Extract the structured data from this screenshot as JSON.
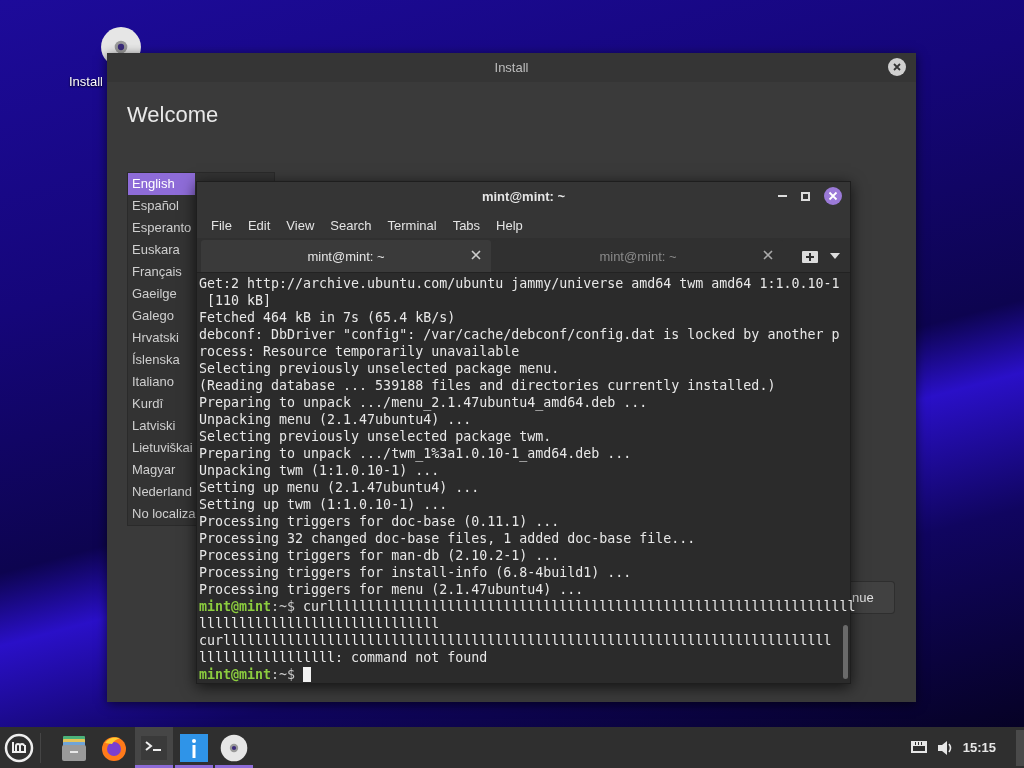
{
  "desktop_icon": {
    "label": "Install"
  },
  "install_window": {
    "title": "Install",
    "heading": "Welcome",
    "languages": [
      {
        "label": "English",
        "selected": true
      },
      {
        "label": "Español",
        "selected": false
      },
      {
        "label": "Esperanto",
        "selected": false
      },
      {
        "label": "Euskara",
        "selected": false
      },
      {
        "label": "Français",
        "selected": false
      },
      {
        "label": "Gaeilge",
        "selected": false
      },
      {
        "label": "Galego",
        "selected": false
      },
      {
        "label": "Hrvatski",
        "selected": false
      },
      {
        "label": "Íslenska",
        "selected": false
      },
      {
        "label": "Italiano",
        "selected": false
      },
      {
        "label": "Kurdî",
        "selected": false
      },
      {
        "label": "Latviski",
        "selected": false
      },
      {
        "label": "Lietuviškai",
        "selected": false
      },
      {
        "label": "Magyar",
        "selected": false
      },
      {
        "label": "Nederland",
        "selected": false
      },
      {
        "label": "No localiza",
        "selected": false
      }
    ],
    "button": "nue"
  },
  "terminal": {
    "title": "mint@mint: ~",
    "menu": [
      "File",
      "Edit",
      "View",
      "Search",
      "Terminal",
      "Tabs",
      "Help"
    ],
    "tabs": [
      {
        "label": "mint@mint: ~",
        "selected": true
      },
      {
        "label": "mint@mint: ~",
        "selected": false
      }
    ],
    "lines": [
      {
        "kind": "text",
        "text": "Get:2 http://archive.ubuntu.com/ubuntu jammy/universe amd64 twm amd64 1:1.0.10-1"
      },
      {
        "kind": "text",
        "text": " [110 kB]"
      },
      {
        "kind": "text",
        "text": "Fetched 464 kB in 7s (65.4 kB/s)"
      },
      {
        "kind": "text",
        "text": "debconf: DbDriver \"config\": /var/cache/debconf/config.dat is locked by another p"
      },
      {
        "kind": "text",
        "text": "rocess: Resource temporarily unavailable"
      },
      {
        "kind": "text",
        "text": "Selecting previously unselected package menu."
      },
      {
        "kind": "text",
        "text": "(Reading database ... 539188 files and directories currently installed.)"
      },
      {
        "kind": "text",
        "text": "Preparing to unpack .../menu_2.1.47ubuntu4_amd64.deb ..."
      },
      {
        "kind": "text",
        "text": "Unpacking menu (2.1.47ubuntu4) ..."
      },
      {
        "kind": "text",
        "text": "Selecting previously unselected package twm."
      },
      {
        "kind": "text",
        "text": "Preparing to unpack .../twm_1%3a1.0.10-1_amd64.deb ..."
      },
      {
        "kind": "text",
        "text": "Unpacking twm (1:1.0.10-1) ..."
      },
      {
        "kind": "text",
        "text": "Setting up menu (2.1.47ubuntu4) ..."
      },
      {
        "kind": "text",
        "text": "Setting up twm (1:1.0.10-1) ..."
      },
      {
        "kind": "text",
        "text": "Processing triggers for doc-base (0.11.1) ..."
      },
      {
        "kind": "text",
        "text": "Processing 32 changed doc-base files, 1 added doc-base file..."
      },
      {
        "kind": "text",
        "text": "Processing triggers for man-db (2.10.2-1) ..."
      },
      {
        "kind": "text",
        "text": "Processing triggers for install-info (6.8-4build1) ..."
      },
      {
        "kind": "text",
        "text": "Processing triggers for menu (2.1.47ubuntu4) ..."
      },
      {
        "kind": "prompt",
        "user": "mint@mint",
        "path": ":~$",
        "command": "curllllllllllllllllllllllllllllllllllllllllllllllllllllllllllllllllll",
        "cursor": false
      },
      {
        "kind": "text",
        "text": "llllllllllllllllllllllllllllll"
      },
      {
        "kind": "text",
        "text": "curllllllllllllllllllllllllllllllllllllllllllllllllllllllllllllllllllllllllllll"
      },
      {
        "kind": "text",
        "text": "lllllllllllllllll: command not found"
      },
      {
        "kind": "prompt",
        "user": "mint@mint",
        "path": ":~$",
        "cursor": true
      }
    ]
  },
  "taskbar": {
    "launchers": [
      {
        "kind": "files",
        "running": false,
        "selected": false
      },
      {
        "kind": "firefox",
        "running": false,
        "selected": false
      },
      {
        "kind": "terminal",
        "running": true,
        "selected": true
      },
      {
        "kind": "info",
        "running": true,
        "selected": false
      },
      {
        "kind": "disc",
        "running": true,
        "selected": false
      }
    ],
    "clock": "15:15"
  }
}
